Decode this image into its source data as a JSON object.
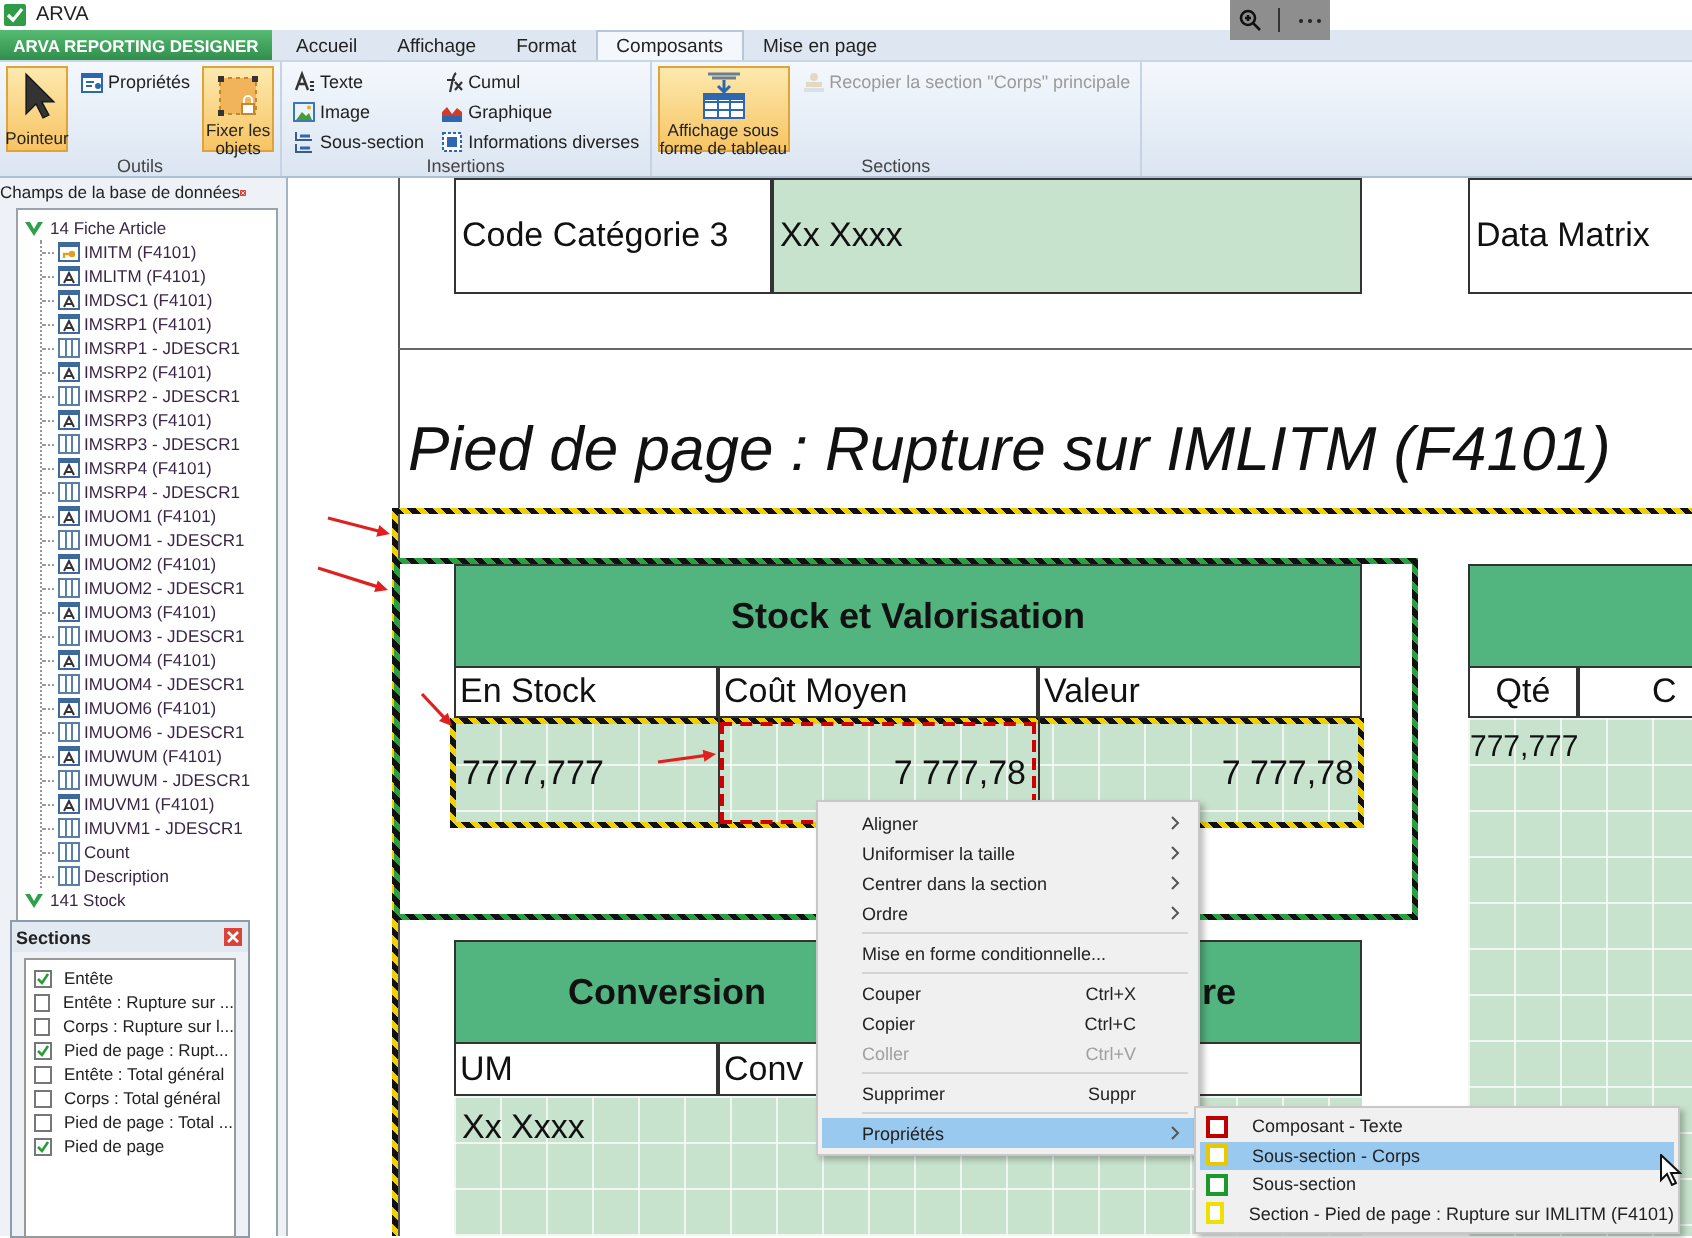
{
  "window": {
    "title": "ARVA"
  },
  "ribbon": {
    "app_tab": "ARVA REPORTING DESIGNER",
    "tabs": [
      {
        "label": "Accueil",
        "selected": false
      },
      {
        "label": "Affichage",
        "selected": false
      },
      {
        "label": "Format",
        "selected": false
      },
      {
        "label": "Composants",
        "selected": true
      },
      {
        "label": "Mise en page",
        "selected": false
      }
    ],
    "groups": [
      {
        "label": "Outils",
        "items": [
          {
            "label": "Pointeur",
            "kind": "large",
            "selected": true,
            "disabled": false
          },
          {
            "label": "Propriétés",
            "kind": "small",
            "selected": false,
            "disabled": false
          },
          {
            "label": "Fixer les objets",
            "kind": "large",
            "selected": true,
            "disabled": false
          }
        ]
      },
      {
        "label": "Insertions",
        "items": [
          {
            "label": "Texte",
            "kind": "small",
            "selected": false,
            "disabled": false
          },
          {
            "label": "Image",
            "kind": "small",
            "selected": false,
            "disabled": false
          },
          {
            "label": "Sous-section",
            "kind": "small",
            "selected": false,
            "disabled": false
          },
          {
            "label": "Cumul",
            "kind": "small",
            "selected": false,
            "disabled": false
          },
          {
            "label": "Graphique",
            "kind": "small",
            "selected": false,
            "disabled": false
          },
          {
            "label": "Informations diverses",
            "kind": "small",
            "selected": false,
            "disabled": false
          }
        ]
      },
      {
        "label": "Sections",
        "items": [
          {
            "label": "Affichage sous forme de tableau",
            "kind": "large",
            "selected": true,
            "disabled": false
          },
          {
            "label": "Recopier la section \"Corps\" principale",
            "kind": "small",
            "selected": false,
            "disabled": true
          }
        ]
      }
    ]
  },
  "fields_panel": {
    "title": "Champs de la base de données",
    "tree": [
      {
        "label": "14 Fiche Article",
        "expanded": true,
        "children": [
          {
            "label": "IMITM (F4101)",
            "kind": "key"
          },
          {
            "label": "IMLITM (F4101)",
            "kind": "text"
          },
          {
            "label": "IMDSC1 (F4101)",
            "kind": "text"
          },
          {
            "label": "IMSRP1 (F4101)",
            "kind": "text"
          },
          {
            "label": "IMSRP1 - JDESCR1",
            "kind": "column"
          },
          {
            "label": "IMSRP2 (F4101)",
            "kind": "text"
          },
          {
            "label": "IMSRP2 - JDESCR1",
            "kind": "column"
          },
          {
            "label": "IMSRP3 (F4101)",
            "kind": "text"
          },
          {
            "label": "IMSRP3 - JDESCR1",
            "kind": "column"
          },
          {
            "label": "IMSRP4 (F4101)",
            "kind": "text"
          },
          {
            "label": "IMSRP4 - JDESCR1",
            "kind": "column"
          },
          {
            "label": "IMUOM1 (F4101)",
            "kind": "text"
          },
          {
            "label": "IMUOM1 - JDESCR1",
            "kind": "column"
          },
          {
            "label": "IMUOM2 (F4101)",
            "kind": "text"
          },
          {
            "label": "IMUOM2 - JDESCR1",
            "kind": "column"
          },
          {
            "label": "IMUOM3 (F4101)",
            "kind": "text"
          },
          {
            "label": "IMUOM3 - JDESCR1",
            "kind": "column"
          },
          {
            "label": "IMUOM4 (F4101)",
            "kind": "text"
          },
          {
            "label": "IMUOM4 - JDESCR1",
            "kind": "column"
          },
          {
            "label": "IMUOM6 (F4101)",
            "kind": "text"
          },
          {
            "label": "IMUOM6 - JDESCR1",
            "kind": "column"
          },
          {
            "label": "IMUWUM (F4101)",
            "kind": "text"
          },
          {
            "label": "IMUWUM - JDESCR1",
            "kind": "column"
          },
          {
            "label": "IMUVM1 (F4101)",
            "kind": "text"
          },
          {
            "label": "IMUVM1 - JDESCR1",
            "kind": "column"
          },
          {
            "label": "Count",
            "kind": "column"
          },
          {
            "label": "Description",
            "kind": "column"
          }
        ]
      },
      {
        "label": "141 Stock",
        "expanded": true
      }
    ]
  },
  "sections_panel": {
    "title": "Sections",
    "items": [
      {
        "label": "Entête",
        "checked": true
      },
      {
        "label": "Entête : Rupture sur ...",
        "checked": false
      },
      {
        "label": "Corps : Rupture sur l...",
        "checked": false
      },
      {
        "label": "Pied de page : Rupt...",
        "checked": true
      },
      {
        "label": "Entête : Total général",
        "checked": false
      },
      {
        "label": "Corps : Total général",
        "checked": false
      },
      {
        "label": "Pied de page : Total ...",
        "checked": false
      },
      {
        "label": "Pied de page",
        "checked": true
      }
    ]
  },
  "report": {
    "top_row": [
      {
        "text": "Code Catégorie 3",
        "kind": "label"
      },
      {
        "text": "Xx Xxxx",
        "kind": "field"
      },
      {
        "text": "Data Matrix",
        "kind": "label"
      }
    ],
    "section_title": "Pied de page : Rupture sur IMLITM (F4101)",
    "tables": [
      {
        "title_parts": [
          "Stock et Valorisation"
        ],
        "columns": [
          "En Stock",
          "Coût Moyen",
          "Valeur"
        ],
        "cells": [
          {
            "text": "7777,777",
            "selected": false
          },
          {
            "text": "7 777,78",
            "selected": true
          },
          {
            "text": "7 777,78",
            "selected": false
          }
        ]
      },
      {
        "title_parts": [
          "Conversion",
          "re"
        ],
        "columns": [
          "UM",
          "Conv"
        ],
        "cells": [
          {
            "text": "Xx Xxxx",
            "selected": false
          }
        ]
      },
      {
        "columns": [
          "Qté",
          "C"
        ],
        "cells": [
          {
            "text": "777,777",
            "selected": false
          }
        ]
      }
    ]
  },
  "context_menu": {
    "items": [
      {
        "kind": "item",
        "label": "Aligner",
        "submenu": true,
        "disabled": false,
        "selected": false
      },
      {
        "kind": "item",
        "label": "Uniformiser la taille",
        "submenu": true,
        "disabled": false,
        "selected": false
      },
      {
        "kind": "item",
        "label": "Centrer dans la section",
        "submenu": true,
        "disabled": false,
        "selected": false
      },
      {
        "kind": "item",
        "label": "Ordre",
        "submenu": true,
        "disabled": false,
        "selected": false
      },
      {
        "kind": "separator"
      },
      {
        "kind": "item",
        "label": "Mise en forme conditionnelle...",
        "submenu": false,
        "disabled": false,
        "selected": false
      },
      {
        "kind": "separator"
      },
      {
        "kind": "item",
        "label": "Couper",
        "shortcut": "Ctrl+X",
        "submenu": false,
        "disabled": false,
        "selected": false
      },
      {
        "kind": "item",
        "label": "Copier",
        "shortcut": "Ctrl+C",
        "submenu": false,
        "disabled": false,
        "selected": false
      },
      {
        "kind": "item",
        "label": "Coller",
        "shortcut": "Ctrl+V",
        "submenu": false,
        "disabled": true,
        "selected": false
      },
      {
        "kind": "separator"
      },
      {
        "kind": "item",
        "label": "Supprimer",
        "shortcut": "Suppr",
        "submenu": false,
        "disabled": false,
        "selected": false
      },
      {
        "kind": "separator"
      },
      {
        "kind": "item",
        "label": "Propriétés",
        "submenu": true,
        "disabled": false,
        "selected": true
      }
    ],
    "submenu": [
      {
        "label": "Composant - Texte",
        "color": "#c00000",
        "selected": false
      },
      {
        "label": "Sous-section - Corps",
        "color": "#e8c800",
        "selected": true
      },
      {
        "label": "Sous-section",
        "color": "#1a9a2a",
        "selected": false
      },
      {
        "label": "Section - Pied de page : Rupture sur IMLITM (F4101)",
        "color": "#f0e000",
        "selected": false
      }
    ]
  }
}
